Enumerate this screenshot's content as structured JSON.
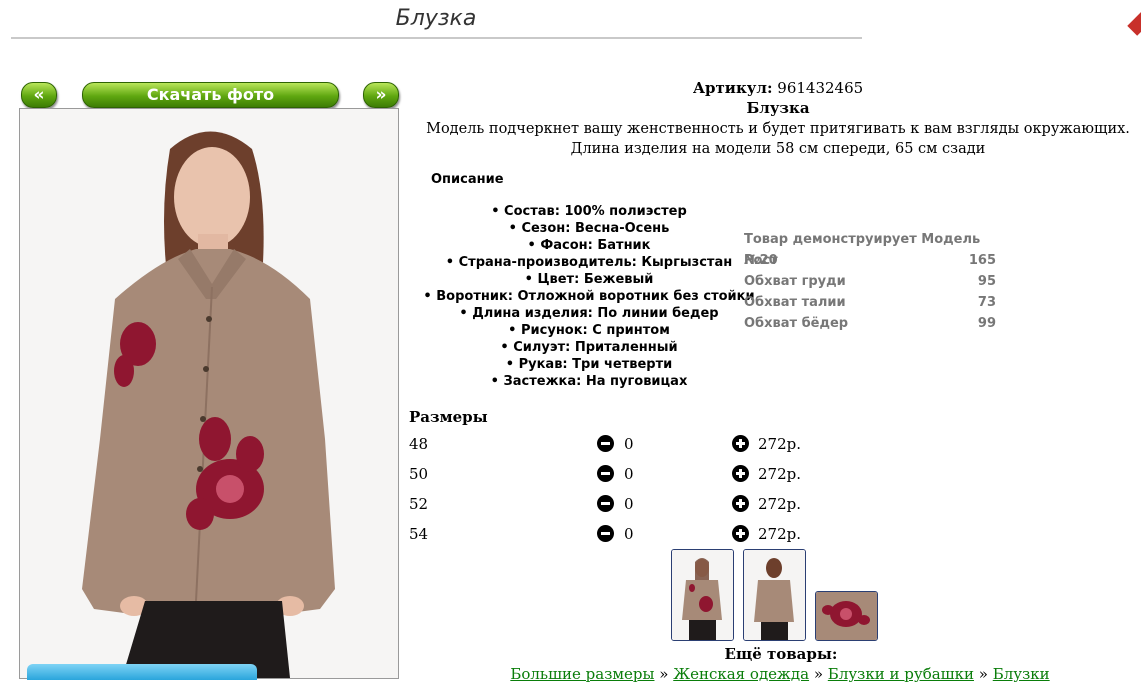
{
  "page": {
    "title": "Блузка"
  },
  "gallery": {
    "prev_label": "«",
    "download_label": "Скачать фото",
    "next_label": "»"
  },
  "product": {
    "sku_label": "Артикул:",
    "sku": "961432465",
    "name": "Блузка",
    "description": "Модель подчеркнет вашу женственность и будет притягивать к вам взгляды окружающих. Длина изделия на модели 58 см спереди, 65 см сзади"
  },
  "description": {
    "heading": "Описание",
    "specs": [
      "Состав: 100% полиэстер",
      "Сезон: Весна-Осень",
      "Фасон: Батник",
      "Страна-производитель: Кыргызстан",
      "Цвет: Бежевый",
      "Воротник: Отложной воротник без стойки",
      "Длина изделия: По линии бедер",
      "Рисунок: С принтом",
      "Силуэт: Приталенный",
      "Рукав: Три четверти",
      "Застежка: На пуговицах"
    ]
  },
  "model": {
    "title": "Товар демонструирует Модель №20",
    "rows": [
      {
        "label": "Рост",
        "value": "165"
      },
      {
        "label": "Обхват груди",
        "value": "95"
      },
      {
        "label": "Обхват талии",
        "value": "73"
      },
      {
        "label": "Обхват бёдер",
        "value": "99"
      }
    ]
  },
  "sizes": {
    "heading": "Размеры",
    "rows": [
      {
        "size": "48",
        "qty": "0",
        "price": "272р."
      },
      {
        "size": "50",
        "qty": "0",
        "price": "272р."
      },
      {
        "size": "52",
        "qty": "0",
        "price": "272р."
      },
      {
        "size": "54",
        "qty": "0",
        "price": "272р."
      }
    ]
  },
  "more": {
    "heading": "Ещё товары:",
    "breadcrumb": [
      "Большие размеры",
      "Женская одежда",
      "Блузки и рубашки",
      "Блузки"
    ],
    "separator": "»"
  },
  "colors": {
    "blouse": "#a78a78",
    "button_green": "#5fa710",
    "link_green": "#0a7d0a",
    "embroidery": "#8f1630"
  }
}
